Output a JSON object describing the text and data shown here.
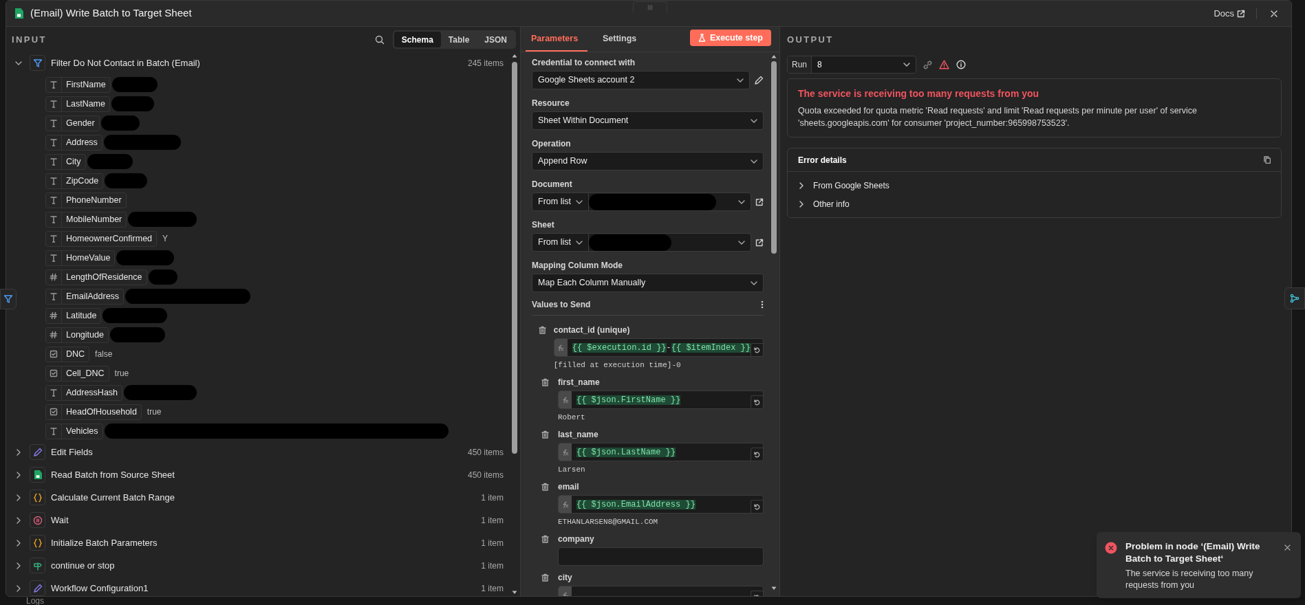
{
  "window": {
    "title": "(Email) Write Batch to Target Sheet",
    "docs_link": "Docs"
  },
  "input": {
    "heading": "INPUT",
    "view_tabs": [
      {
        "label": "Schema",
        "selected": true
      },
      {
        "label": "Table",
        "selected": false
      },
      {
        "label": "JSON",
        "selected": false
      }
    ],
    "nodes": [
      {
        "name": "Filter Do Not Contact in Batch (Email)",
        "kind": "filter",
        "count": "245 items",
        "expanded": true,
        "fields": [
          {
            "name": "FirstName",
            "kind": "string",
            "redacted": true
          },
          {
            "name": "LastName",
            "kind": "string",
            "redacted": true
          },
          {
            "name": "Gender",
            "kind": "string",
            "redacted": true
          },
          {
            "name": "Address",
            "kind": "string",
            "redacted": true
          },
          {
            "name": "City",
            "kind": "string",
            "redacted": true
          },
          {
            "name": "ZipCode",
            "kind": "string",
            "redacted": true
          },
          {
            "name": "PhoneNumber",
            "kind": "string"
          },
          {
            "name": "MobileNumber",
            "kind": "string",
            "redacted": true
          },
          {
            "name": "HomeownerConfirmed",
            "kind": "string",
            "value": "Y"
          },
          {
            "name": "HomeValue",
            "kind": "string",
            "redacted": true
          },
          {
            "name": "LengthOfResidence",
            "kind": "number",
            "redacted": true
          },
          {
            "name": "EmailAddress",
            "kind": "string",
            "redacted": true
          },
          {
            "name": "Latitude",
            "kind": "number",
            "redacted": true
          },
          {
            "name": "Longitude",
            "kind": "number",
            "redacted": true
          },
          {
            "name": "DNC",
            "kind": "boolean",
            "value": "false"
          },
          {
            "name": "Cell_DNC",
            "kind": "boolean",
            "value": "true"
          },
          {
            "name": "AddressHash",
            "kind": "string",
            "redacted": true
          },
          {
            "name": "HeadOfHousehold",
            "kind": "boolean",
            "value": "true"
          },
          {
            "name": "Vehicles",
            "kind": "string",
            "redacted": true
          }
        ]
      },
      {
        "name": "Edit Fields",
        "kind": "pencil",
        "count": "450 items",
        "expanded": false
      },
      {
        "name": "Read Batch from Source Sheet",
        "kind": "sheets",
        "count": "450 items",
        "expanded": false
      },
      {
        "name": "Calculate Current Batch Range",
        "kind": "code",
        "count": "1 item",
        "expanded": false
      },
      {
        "name": "Wait",
        "kind": "pause",
        "count": "1 item",
        "expanded": false
      },
      {
        "name": "Initialize Batch Parameters",
        "kind": "code",
        "count": "1 item",
        "expanded": false
      },
      {
        "name": "continue or stop",
        "kind": "branch",
        "count": "1 item",
        "expanded": false
      },
      {
        "name": "Workflow Configuration1",
        "kind": "pencil",
        "count": "1 item",
        "expanded": false
      }
    ]
  },
  "parameters": {
    "tabs": [
      {
        "label": "Parameters",
        "selected": true
      },
      {
        "label": "Settings",
        "selected": false
      }
    ],
    "execute_button": "Execute step",
    "fields": [
      {
        "kind": "credential",
        "label": "Credential to connect with",
        "value": "Google Sheets account 2"
      },
      {
        "kind": "select",
        "label": "Resource",
        "value": "Sheet Within Document"
      },
      {
        "kind": "select",
        "label": "Operation",
        "value": "Append Row"
      },
      {
        "kind": "locator",
        "label": "Document",
        "mode": "From list",
        "redacted": true
      },
      {
        "kind": "locator",
        "label": "Sheet",
        "mode": "From list",
        "redacted": true
      },
      {
        "kind": "select",
        "label": "Mapping Column Mode",
        "value": "Map Each Column Manually"
      }
    ],
    "values_to_send": {
      "heading": "Values to Send",
      "mappings": [
        {
          "kind": "expression",
          "name": "contact_id (unique)",
          "expression": "{{ $execution.id }}-{{ $itemIndex }}",
          "preview": "[filled at execution time]-0"
        },
        {
          "kind": "expression",
          "name": "first_name",
          "expression": "{{ $json.FirstName }}",
          "preview": "Robert"
        },
        {
          "kind": "expression",
          "name": "last_name",
          "expression": "{{ $json.LastName }}",
          "preview": "Larsen"
        },
        {
          "kind": "expression",
          "name": "email",
          "expression": "{{ $json.EmailAddress }}",
          "preview": "ETHANLARSEN8@GMAIL.COM"
        },
        {
          "kind": "empty",
          "name": "company"
        },
        {
          "kind": "expression",
          "name": "city"
        }
      ]
    }
  },
  "output": {
    "heading": "OUTPUT",
    "run": {
      "label": "Run",
      "value": "8"
    },
    "error": {
      "title": "The service is receiving too many requests from you",
      "message": "Quota exceeded for quota metric 'Read requests' and limit 'Read requests per minute per user' of service 'sheets.googleapis.com' for consumer 'project_number:965998753523'."
    },
    "details": {
      "title": "Error details",
      "items": [
        {
          "label": "From Google Sheets",
          "expanded": false
        },
        {
          "label": "Other info",
          "expanded": false
        }
      ]
    }
  },
  "toast": {
    "title": "Problem in node ‘(Email) Write Batch to Target Sheet‘",
    "message": "The service is receiving too many requests from you"
  },
  "footer": {
    "logs": "Logs"
  }
}
